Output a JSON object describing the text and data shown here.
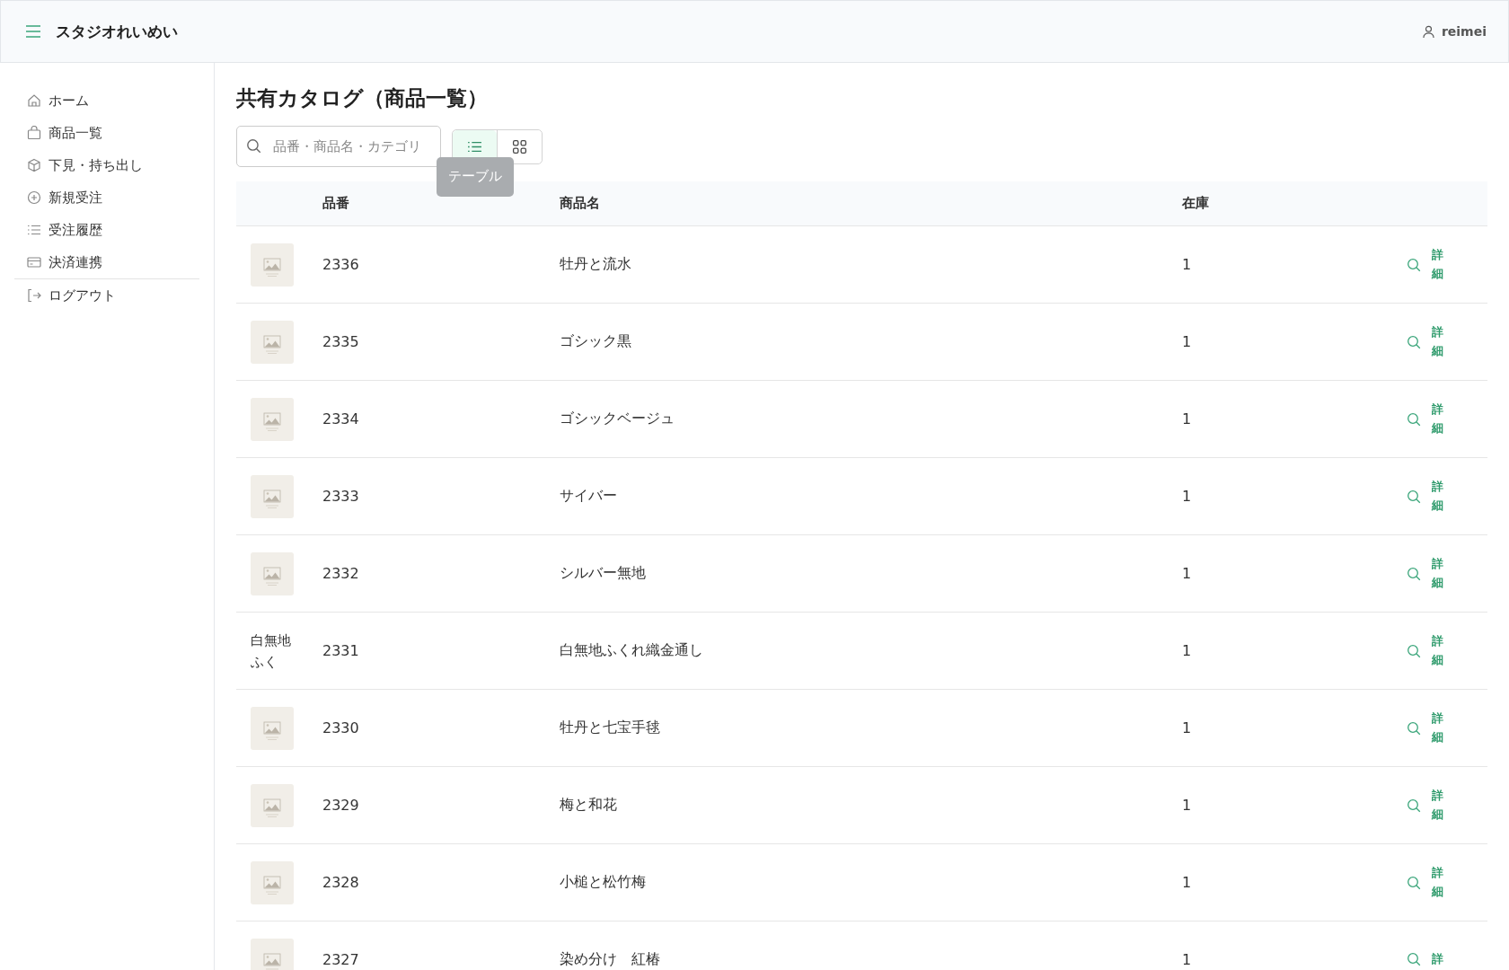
{
  "header": {
    "brand": "スタジオれいめい",
    "user": "reimei"
  },
  "sidebar": {
    "items": [
      {
        "label": "ホーム",
        "kind": "home",
        "divider_before": false
      },
      {
        "label": "商品一覧",
        "kind": "bag",
        "divider_before": false
      },
      {
        "label": "下見・持ち出し",
        "kind": "box",
        "divider_before": false
      },
      {
        "label": "新規受注",
        "kind": "plus",
        "divider_before": false
      },
      {
        "label": "受注履歴",
        "kind": "list",
        "divider_before": false
      },
      {
        "label": "決済連携",
        "kind": "card",
        "divider_before": false
      },
      {
        "label": "ログアウト",
        "kind": "logout",
        "divider_before": true
      }
    ]
  },
  "page": {
    "title": "共有カタログ（商品一覧）"
  },
  "search": {
    "placeholder": "品番・商品名・カテゴリ"
  },
  "view_toggle": [
    {
      "kind": "list",
      "selected": true,
      "tooltip": "テーブル"
    },
    {
      "kind": "grid",
      "selected": false
    }
  ],
  "table": {
    "columns": [
      "品番",
      "商品名",
      "在庫"
    ],
    "rows": [
      {
        "thumb": {
          "kind": "placeholder"
        },
        "code": "2336",
        "name": "牡丹と流水",
        "stock": "1",
        "action": "詳細"
      },
      {
        "thumb": {
          "kind": "placeholder"
        },
        "code": "2335",
        "name": "ゴシック黒",
        "stock": "1",
        "action": "詳細"
      },
      {
        "thumb": {
          "kind": "placeholder"
        },
        "code": "2334",
        "name": "ゴシックベージュ",
        "stock": "1",
        "action": "詳細"
      },
      {
        "thumb": {
          "kind": "placeholder"
        },
        "code": "2333",
        "name": "サイバー",
        "stock": "1",
        "action": "詳細"
      },
      {
        "thumb": {
          "kind": "placeholder"
        },
        "code": "2332",
        "name": "シルバー無地",
        "stock": "1",
        "action": "詳細"
      },
      {
        "thumb": {
          "kind": "broken",
          "alt": "白無地ふく"
        },
        "code": "2331",
        "name": "白無地ふくれ織金通し",
        "stock": "1",
        "action": "詳細"
      },
      {
        "thumb": {
          "kind": "placeholder"
        },
        "code": "2330",
        "name": "牡丹と七宝手毬",
        "stock": "1",
        "action": "詳細"
      },
      {
        "thumb": {
          "kind": "placeholder"
        },
        "code": "2329",
        "name": "梅と和花",
        "stock": "1",
        "action": "詳細"
      },
      {
        "thumb": {
          "kind": "placeholder"
        },
        "code": "2328",
        "name": "小槌と松竹梅",
        "stock": "1",
        "action": "詳細"
      },
      {
        "thumb": {
          "kind": "placeholder"
        },
        "code": "2327",
        "name": "染め分け　紅椿",
        "stock": "1",
        "action": "詳"
      }
    ]
  }
}
